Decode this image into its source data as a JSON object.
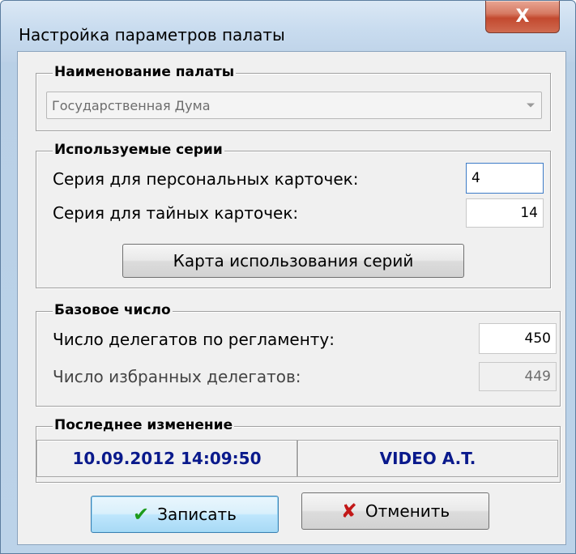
{
  "window": {
    "title": "Настройка параметров палаты",
    "close_glyph": "X"
  },
  "chamber_group": {
    "title": "Наименование палаты",
    "selected_value": "Государственная Дума"
  },
  "series_group": {
    "title": "Используемые серии",
    "personal_label": "Серия для персональных карточек:",
    "personal_value": "4",
    "secret_label": "Серия для тайных карточек:",
    "secret_value": "14",
    "map_button_label": "Карта использования серий"
  },
  "base_group": {
    "title": "Базовое число",
    "regulation_label": "Число делегатов по регламенту:",
    "regulation_value": "450",
    "elected_label": "Число избранных делегатов:",
    "elected_value": "449"
  },
  "last_change_group": {
    "title": "Последнее изменение",
    "datetime": "10.09.2012 14:09:50",
    "user": "VIDEO A.T."
  },
  "buttons": {
    "save_label": "Записать",
    "cancel_label": "Отменить"
  },
  "colors": {
    "accent_text": "#0a1a8c",
    "save_icon": "#1c9b1c",
    "cancel_icon": "#c21818"
  },
  "icons": {
    "save": "check-icon",
    "cancel": "cross-icon"
  }
}
